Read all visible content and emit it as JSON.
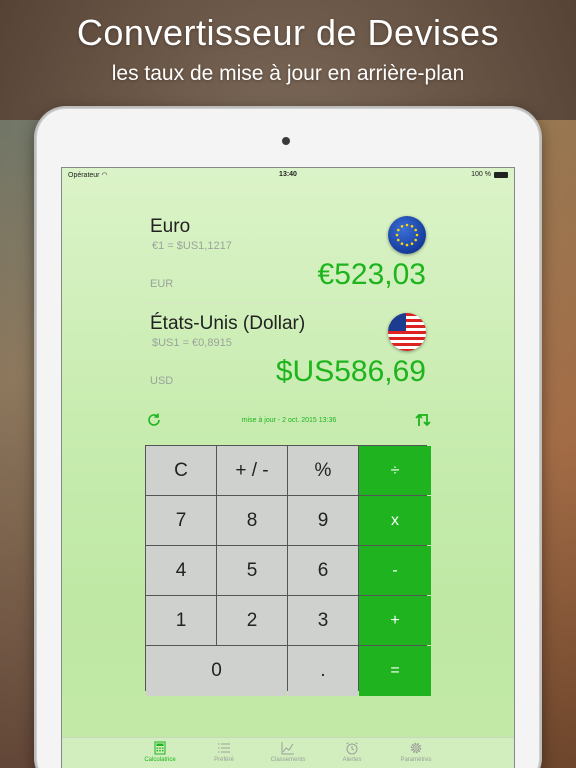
{
  "headline": "Convertisseur de Devises",
  "subline": "les taux de mise à jour en arrière-plan",
  "status_bar": {
    "carrier": "Opérateur",
    "time": "13:40",
    "battery": "100 %"
  },
  "currencies": [
    {
      "name": "Euro",
      "rate": "€1 =  $US1,1217",
      "code": "EUR",
      "amount": "€523,03",
      "flag_icon": "eu-flag-icon"
    },
    {
      "name": "États-Unis (Dollar)",
      "rate": "$US1 =  €0,8915",
      "code": "USD",
      "amount": "$US586,69",
      "flag_icon": "us-flag-icon"
    }
  ],
  "update_text": "mise à jour - 2 oct. 2015 13:36",
  "keypad": {
    "keys": [
      "C",
      "+ / -",
      "%",
      "÷",
      "7",
      "8",
      "9",
      "x",
      "4",
      "5",
      "6",
      "-",
      "1",
      "2",
      "3",
      "+",
      "0",
      ".",
      "="
    ]
  },
  "tabs": [
    {
      "label": "Calculatrice",
      "icon": "calculator-icon",
      "active": true
    },
    {
      "label": "Préféré",
      "icon": "list-icon",
      "active": false
    },
    {
      "label": "Classements",
      "icon": "chart-icon",
      "active": false
    },
    {
      "label": "Alertes",
      "icon": "alarm-clock-icon",
      "active": false
    },
    {
      "label": "Paramètres",
      "icon": "gear-icon",
      "active": false
    }
  ],
  "colors": {
    "accent_green": "#1db41d",
    "key_gray": "#cfd1cf",
    "screen_bg": "#c8ecb0"
  }
}
